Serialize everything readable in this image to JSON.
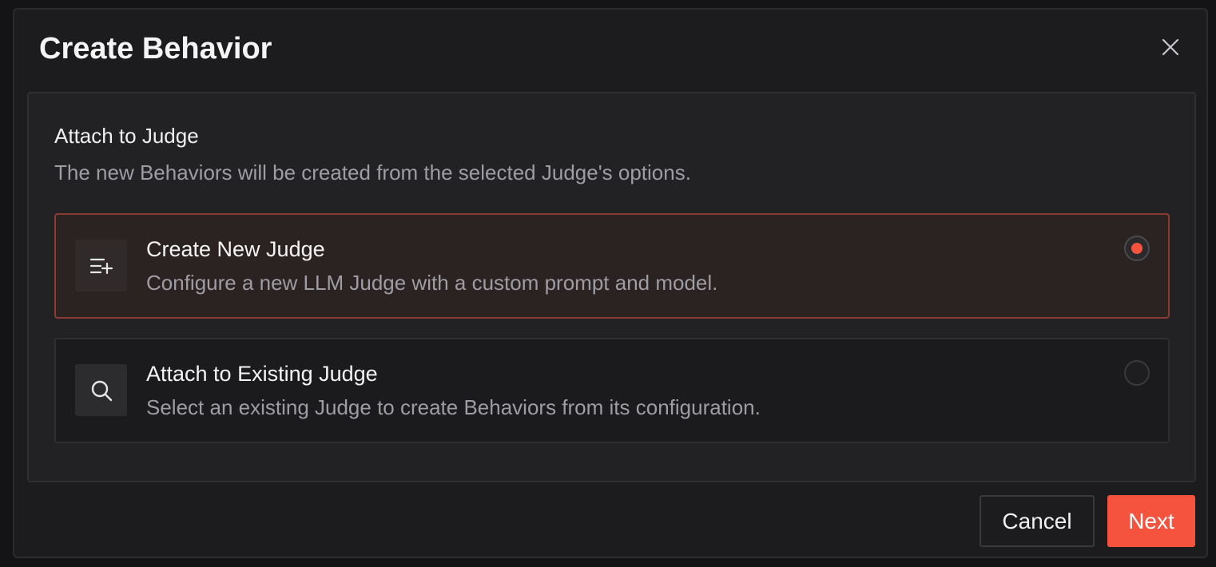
{
  "dialog": {
    "title": "Create Behavior",
    "close_icon": "close-icon"
  },
  "section": {
    "title": "Attach to Judge",
    "description": "The new Behaviors will be created from the selected Judge's options."
  },
  "options": [
    {
      "title": "Create New Judge",
      "description": "Configure a new LLM Judge with a custom prompt and model.",
      "icon": "list-add-icon",
      "selected": true
    },
    {
      "title": "Attach to Existing Judge",
      "description": "Select an existing Judge to create Behaviors from its configuration.",
      "icon": "search-icon",
      "selected": false
    }
  ],
  "footer": {
    "cancel_label": "Cancel",
    "next_label": "Next"
  },
  "colors": {
    "accent": "#f5533d",
    "background": "#1c1c1e",
    "selected_border": "#8a3a33"
  }
}
